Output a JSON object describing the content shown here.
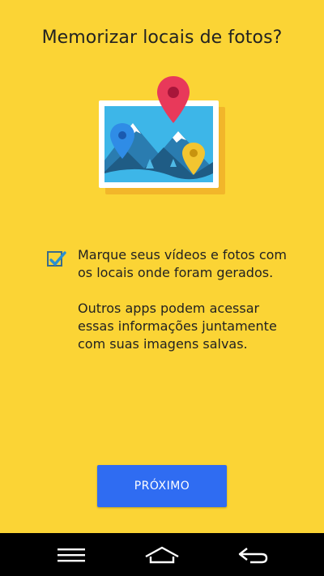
{
  "page": {
    "title": "Memorizar locais de fotos?"
  },
  "illustration": {
    "icon": "photo-location-pins-icon",
    "pin_colors": [
      "#e8395a",
      "#2f8ce6",
      "#f3c530"
    ],
    "photo_colors": {
      "sky": "#3db6e8",
      "mountain": "#1f5c85",
      "frame": "#ffffff"
    }
  },
  "option": {
    "checked": true,
    "text_primary": "Marque seus vídeos e fotos com os locais onde foram gerados.",
    "text_secondary": "Outros apps podem acessar essas informações juntamente com suas imagens salvas."
  },
  "actions": {
    "next_label": "PRÓXIMO",
    "next_color": "#2f6cf2"
  },
  "navbar": {
    "icons": [
      "menu-icon",
      "home-icon",
      "back-icon"
    ]
  },
  "colors": {
    "background": "#fbd435",
    "navbar": "#000000"
  }
}
